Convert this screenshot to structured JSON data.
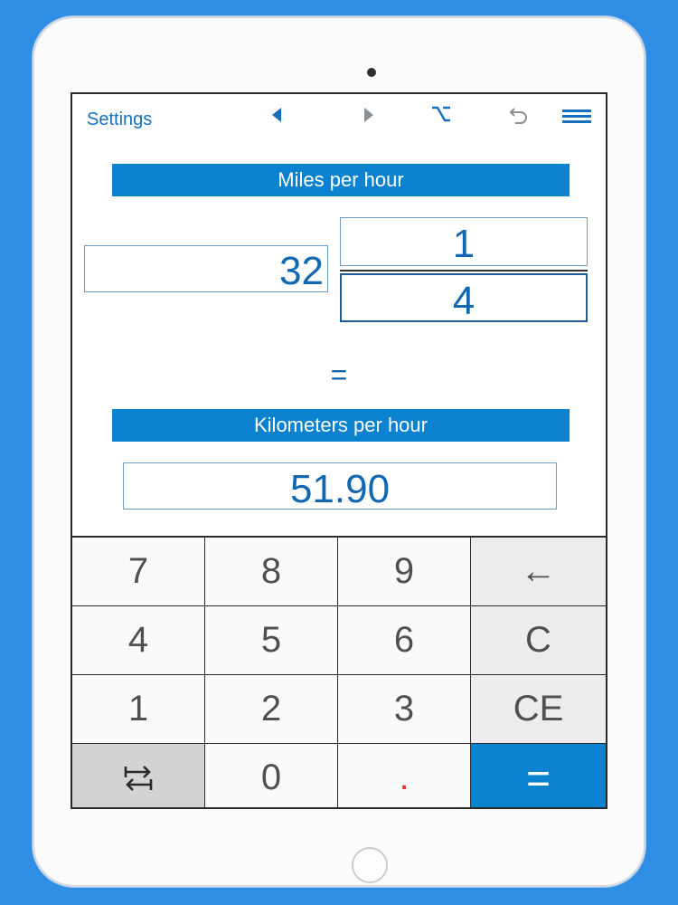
{
  "toolbar": {
    "settings_label": "Settings",
    "icons": [
      "left-arrow-icon",
      "right-arrow-icon",
      "option-icon",
      "undo-icon",
      "menu-icon"
    ]
  },
  "converter": {
    "from_unit": "Miles per hour",
    "whole": "32",
    "numerator": "1",
    "denominator": "4",
    "equals": "=",
    "to_unit": "Kilometers per hour",
    "result": "51.90"
  },
  "keypad": {
    "rows": [
      [
        "7",
        "8",
        "9",
        "←"
      ],
      [
        "4",
        "5",
        "6",
        "C"
      ],
      [
        "1",
        "2",
        "3",
        "CE"
      ],
      [
        "⇆",
        "0",
        ".",
        "="
      ]
    ]
  },
  "colors": {
    "accent": "#0a82d0",
    "background": "#2f8de4",
    "text_blue": "#1267b3",
    "dot_red": "#e5342a"
  }
}
